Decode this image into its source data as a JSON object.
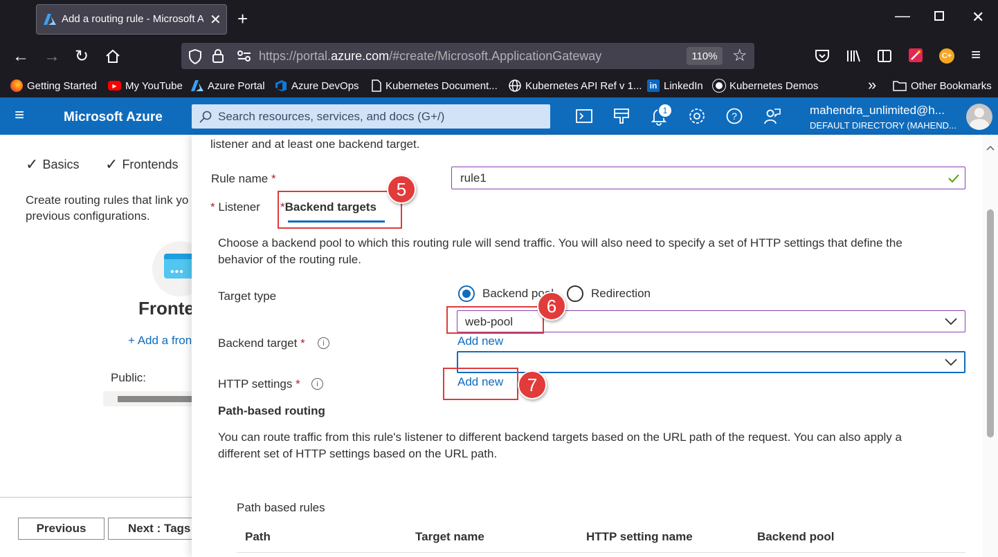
{
  "browser": {
    "tab_title": "Add a routing rule - Microsoft Azure",
    "url_prefix": "https://portal.",
    "url_domain": "azure.com",
    "url_path": "/#create/Microsoft.ApplicationGateway",
    "zoom": "110%",
    "bookmarks": [
      "Getting Started",
      "My YouTube",
      "Azure Portal",
      "Azure DevOps",
      "Kubernetes Document...",
      "Kubernetes API Ref v 1...",
      "LinkedIn",
      "Kubernetes Demos"
    ],
    "other_bookmarks": "Other Bookmarks"
  },
  "azure": {
    "brand": "Microsoft Azure",
    "search_placeholder": "Search resources, services, and docs (G+/)",
    "notification_count": "1",
    "user_name": "mahendra_unlimited@h...",
    "user_directory": "DEFAULT DIRECTORY (MAHEND..."
  },
  "left": {
    "steps": [
      "Basics",
      "Frontends"
    ],
    "description_line1": "Create routing rules that link yo",
    "description_line2": "previous configurations.",
    "frontend_title": "Fronte",
    "add_frontend": "+ Add a fron",
    "public_label": "Public:",
    "previous_button": "Previous",
    "next_button": "Next : Tags"
  },
  "form": {
    "intro": "listener and at least one backend target.",
    "rule_name_label": "Rule name",
    "rule_name_value": "rule1",
    "tab_listener": "Listener",
    "tab_backend": "Backend targets",
    "backend_description_1": "Choose a backend pool to which this routing rule will send traffic. You will also need to specify a set of HTTP settings that define the",
    "backend_description_2": "behavior of the routing rule.",
    "target_type_label": "Target type",
    "radio_backend_pool": "Backend pool",
    "radio_redirection": "Redirection",
    "backend_target_label": "Backend target",
    "backend_target_value": "web-pool",
    "add_new_backend": "Add new",
    "http_settings_label": "HTTP settings",
    "http_settings_value": "",
    "add_new_http": "Add new",
    "path_routing_heading": "Path-based routing",
    "path_routing_desc_1": "You can route traffic from this rule's listener to different backend targets based on the URL path of the request. You can also apply a",
    "path_routing_desc_2": "different set of HTTP settings based on the URL path.",
    "path_rules_label": "Path based rules",
    "table_headers": [
      "Path",
      "Target name",
      "HTTP setting name",
      "Backend pool"
    ]
  },
  "annotations": [
    "5",
    "6",
    "7"
  ],
  "colors": {
    "azure_blue": "#0f6cbd",
    "annotation_red": "#e23b3b",
    "browser_dark": "#1c1b22"
  }
}
